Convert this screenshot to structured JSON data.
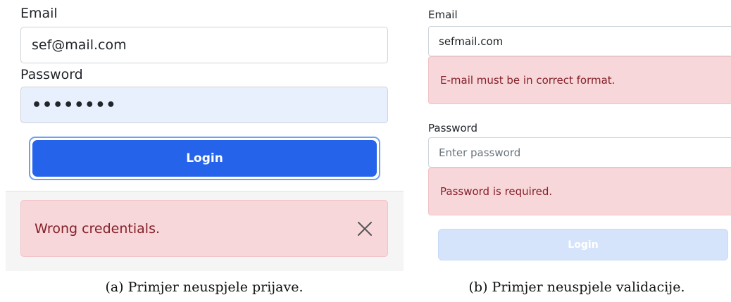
{
  "panel_a": {
    "email_label": "Email",
    "email_value": "sef@mail.com",
    "password_label": "Password",
    "password_value": "••••••••",
    "login_button": "Login",
    "alert_text": "Wrong credentials.",
    "close_icon": "close-x-icon"
  },
  "panel_b": {
    "email_label": "Email",
    "email_value": "sefmail.com",
    "email_error": "E-mail must be in correct format.",
    "password_label": "Password",
    "password_placeholder": "Enter password",
    "password_error": "Password is required.",
    "login_button": "Login"
  },
  "captions": {
    "a": "(a) Primjer neuspjele prijave.",
    "b": "(b) Primjer neuspjele validacije."
  },
  "colors": {
    "primary": "#2563eb",
    "primary_disabled": "#d6e4fb",
    "alert_bg": "#f8d7da",
    "alert_text": "#842029",
    "autofill_bg": "#e8f0fe"
  }
}
